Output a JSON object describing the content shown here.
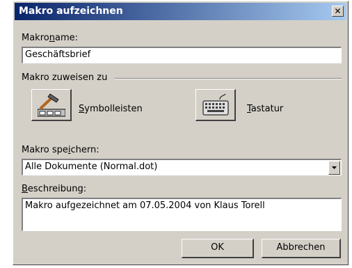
{
  "window": {
    "title": "Makro aufzeichnen"
  },
  "macro_name": {
    "label_pre": "Makro",
    "label_ul": "n",
    "label_post": "ame:",
    "value": "Geschäftsbrief"
  },
  "assign": {
    "label": "Makro zuweisen zu",
    "toolbars": {
      "ul": "S",
      "rest": "ymbolleisten"
    },
    "keyboard": {
      "ul": "T",
      "rest": "astatur"
    }
  },
  "store": {
    "label_pre": "Makro spe",
    "label_ul": "i",
    "label_post": "chern:",
    "value": "Alle Dokumente (Normal.dot)"
  },
  "description": {
    "label_ul": "B",
    "label_post": "eschreibung:",
    "value": "Makro aufgezeichnet am 07.05.2004 von Klaus Torell"
  },
  "buttons": {
    "ok": "OK",
    "cancel": "Abbrechen"
  },
  "icons": {
    "close": "close-icon",
    "toolbars": "hammer-toolbar-icon",
    "keyboard": "keyboard-icon",
    "dropdown": "chevron-down-icon"
  }
}
